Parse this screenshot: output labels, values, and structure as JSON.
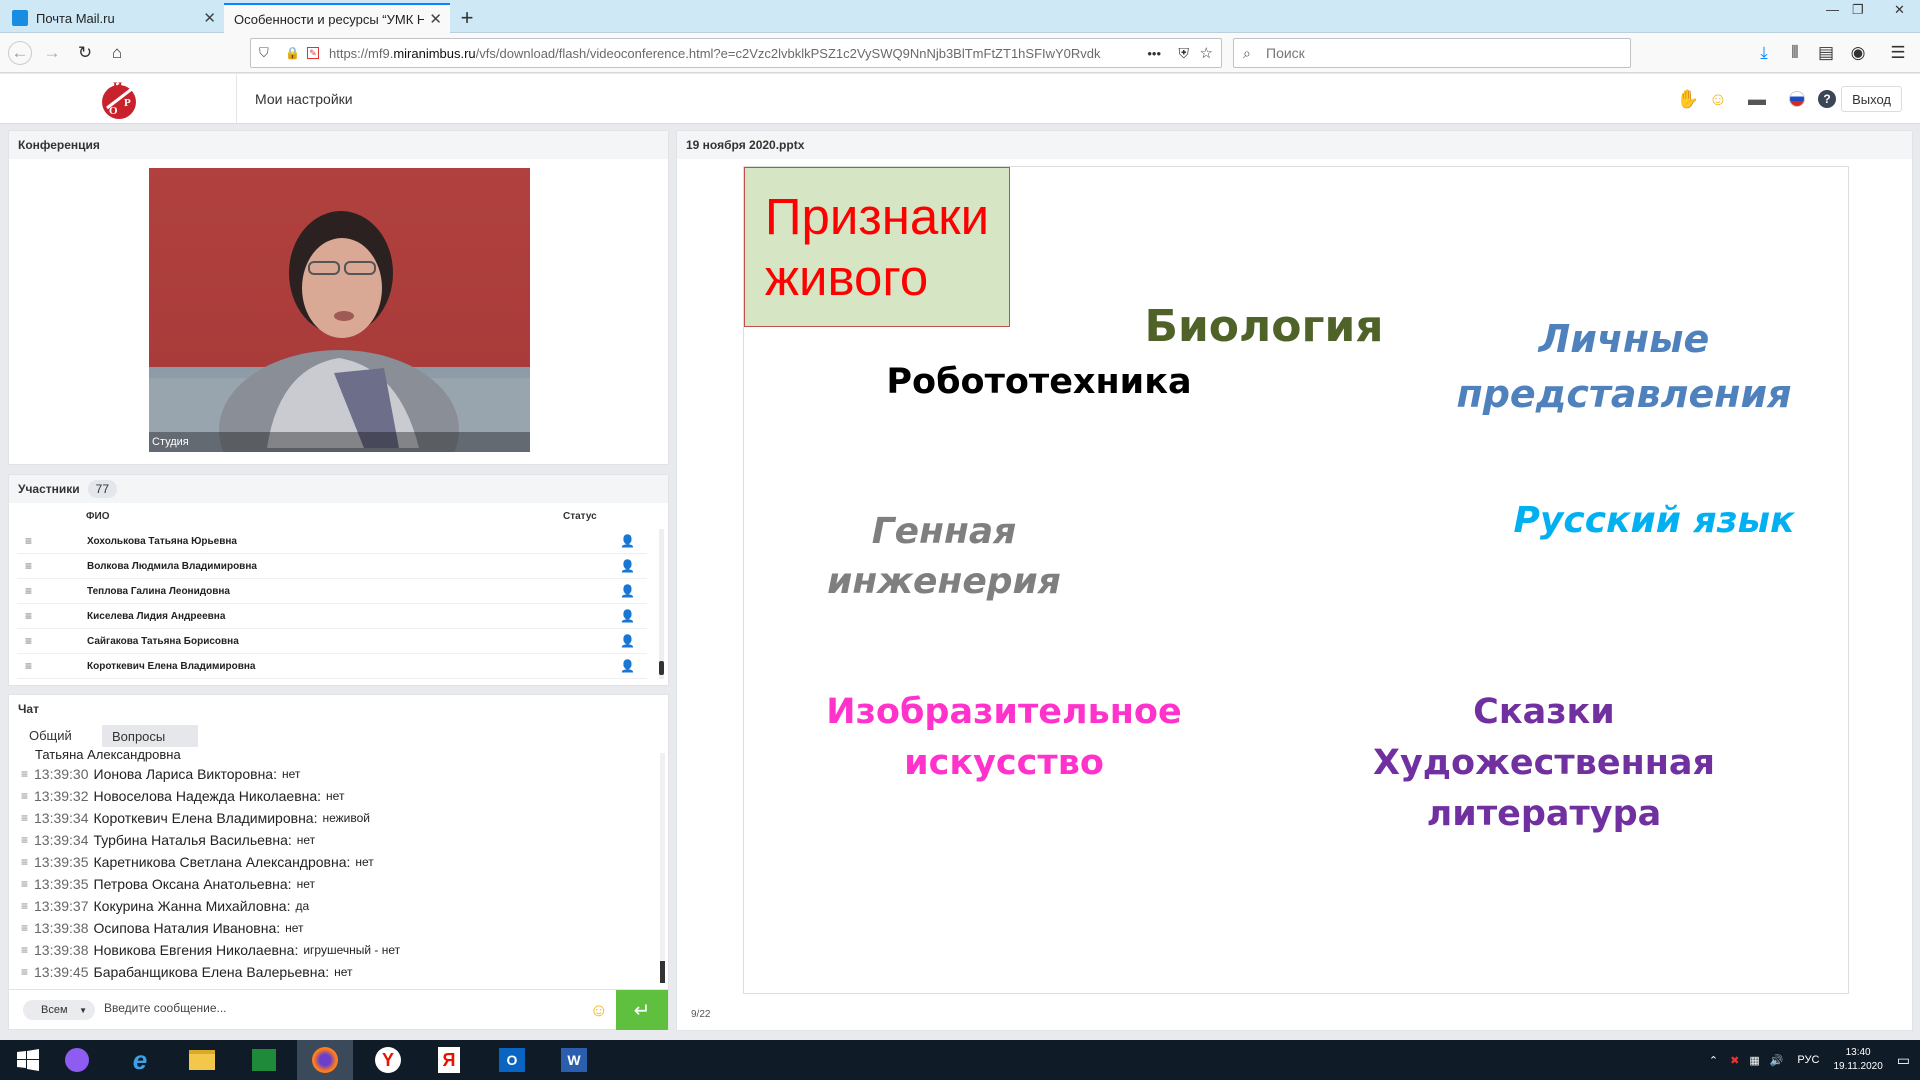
{
  "browser": {
    "tabs": [
      {
        "title": "Почта Mail.ru"
      },
      {
        "title": "Особенности и ресурсы “УМК НС"
      }
    ],
    "url_prefix": "https://mf9.",
    "url_host": "miranimbus.ru",
    "url_path": "/vfs/download/flash/videoconference.html?e=c2Vzc2lvbklkPSZ1c2VySWQ9NnNjb3BlTmFtZT1hSFIwY0Rvdk",
    "url_ellipsis": "•••",
    "search_placeholder": "Поиск"
  },
  "app": {
    "settings_label": "Мои настройки",
    "exit_label": "Выход",
    "logo_letters": "ИРО"
  },
  "conference": {
    "title": "Конференция",
    "video_label": "Студия"
  },
  "participants": {
    "title": "Участники",
    "count": "77",
    "col_name": "ФИО",
    "col_status": "Статус",
    "rows": [
      {
        "name": "Хохолькова Татьяна  Юрьевна"
      },
      {
        "name": "Волкова Людмила  Владимировна"
      },
      {
        "name": "Теплова Галина  Леонидовна"
      },
      {
        "name": "Киселева  Лидия Андреевна"
      },
      {
        "name": "Сайгакова Татьяна  Борисовна"
      },
      {
        "name": "Короткевич Елена  Владимировна"
      }
    ]
  },
  "chat": {
    "title": "Чат",
    "tab_general": "Общий",
    "tab_questions": "Вопросы",
    "partial_line": "Татьяна Александровна",
    "messages": [
      {
        "time": "13:39:30",
        "author": "Ионова Лариса  Викторовна:",
        "text": "нет"
      },
      {
        "time": "13:39:32",
        "author": "Новоселова Надежда  Николаевна:",
        "text": "нет"
      },
      {
        "time": "13:39:34",
        "author": "Короткевич Елена  Владимировна:",
        "text": "неживой"
      },
      {
        "time": "13:39:34",
        "author": "Турбина Наталья  Васильевна:",
        "text": "нет"
      },
      {
        "time": "13:39:35",
        "author": "Каретникова Светлана  Александровна:",
        "text": "нет"
      },
      {
        "time": "13:39:35",
        "author": "Петрова  Оксана  Анатольевна:",
        "text": "нет"
      },
      {
        "time": "13:39:37",
        "author": "Кокурина Жанна  Михайловна:",
        "text": "да"
      },
      {
        "time": "13:39:38",
        "author": "Осипова Наталия  Ивановна:",
        "text": "нет"
      },
      {
        "time": "13:39:38",
        "author": "Новикова Евгения  Николаевна:",
        "text": "игрушечный - нет"
      },
      {
        "time": "13:39:45",
        "author": "Барабанщикова Елена Валерьевна:",
        "text": "нет"
      }
    ],
    "recipient": "Всем",
    "input_placeholder": "Введите сообщение...",
    "send_icon": "↵"
  },
  "presentation": {
    "file_name": "19 ноября 2020.pptx",
    "page": "9/22",
    "center_text": "Признаки\nживого",
    "words": [
      {
        "id": "bio",
        "text": "Биология",
        "color": "#4f6228"
      },
      {
        "id": "robot",
        "text": "Робототехника",
        "color": "#000000"
      },
      {
        "id": "lichnye",
        "text": "Личные\nпредставления",
        "color": "#4f81bd"
      },
      {
        "id": "gene",
        "text": "Генная\nинженерия",
        "color": "#7f7f7f"
      },
      {
        "id": "rus",
        "text": "Русский язык",
        "color": "#00b0f0"
      },
      {
        "id": "izo",
        "text": "Изобразительное\nискусство",
        "color": "#ff33cc"
      },
      {
        "id": "skazki",
        "text": "Сказки\nХудожественная литература",
        "color": "#7030a0"
      }
    ]
  },
  "taskbar": {
    "lang": "РУС",
    "time": "13:40",
    "date": "19.11.2020"
  },
  "colors": {
    "accent_blue": "#0a84ff",
    "send_green": "#5fbf3f",
    "center_fill": "#d6e5c4",
    "center_text": "#ff0000"
  }
}
